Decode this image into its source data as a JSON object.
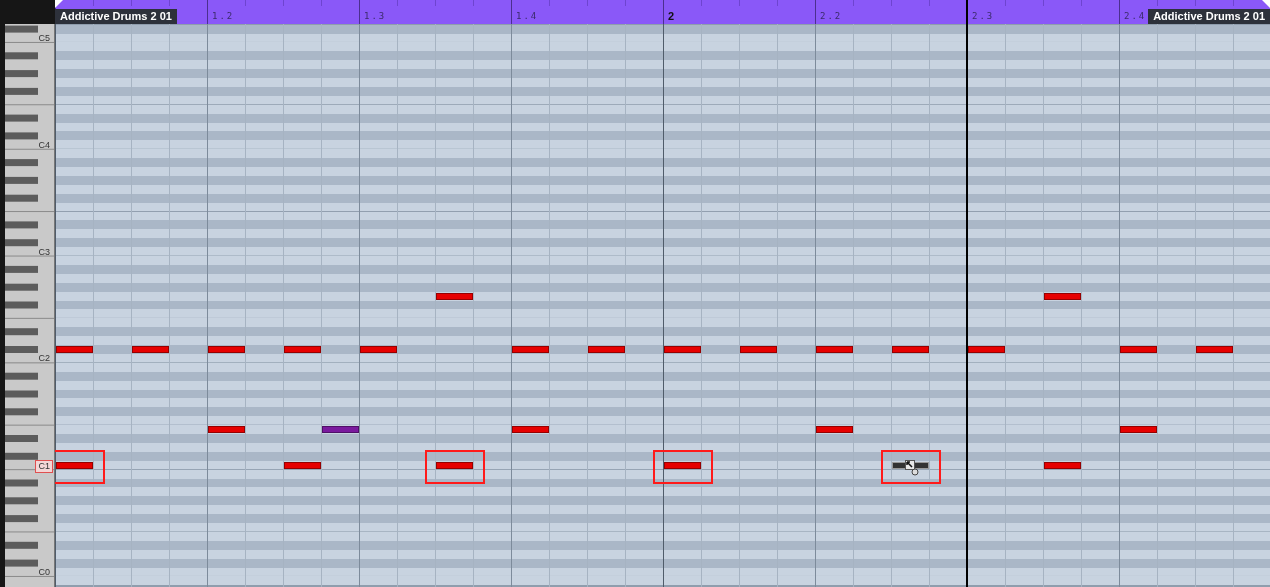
{
  "regions": [
    {
      "label": "Addictive Drums 2 01"
    },
    {
      "label": "Addictive Drums 2 01"
    }
  ],
  "ruler": {
    "beats": [
      {
        "label": "1.2",
        "kind": "beat",
        "playhead": false
      },
      {
        "label": "1.3",
        "kind": "beat",
        "playhead": false
      },
      {
        "label": "1.4",
        "kind": "beat",
        "playhead": false
      },
      {
        "label": "2",
        "kind": "bar",
        "playhead": false
      },
      {
        "label": "2.2",
        "kind": "beat",
        "playhead": false
      },
      {
        "label": "2.3",
        "kind": "beat",
        "playhead": true
      },
      {
        "label": "2.4",
        "kind": "beat",
        "playhead": false
      }
    ]
  },
  "keyboard": {
    "octaves": [
      {
        "label": "C5",
        "selected": false
      },
      {
        "label": "C4",
        "selected": false
      },
      {
        "label": "C3",
        "selected": false
      },
      {
        "label": "C2",
        "selected": false
      },
      {
        "label": "C1",
        "selected": true
      },
      {
        "label": "C0",
        "selected": false
      }
    ]
  },
  "rows": [
    {
      "black_key": true
    },
    {
      "black_key": false
    },
    {
      "black_key": false
    },
    {
      "black_key": true
    },
    {
      "black_key": false
    },
    {
      "black_key": true
    },
    {
      "black_key": false
    },
    {
      "black_key": true
    },
    {
      "black_key": false
    },
    {
      "black_key": false
    },
    {
      "black_key": true
    },
    {
      "black_key": false
    },
    {
      "black_key": true
    },
    {
      "black_key": false
    },
    {
      "black_key": false
    },
    {
      "black_key": true
    },
    {
      "black_key": false
    },
    {
      "black_key": true
    },
    {
      "black_key": false
    },
    {
      "black_key": true
    },
    {
      "black_key": false
    },
    {
      "black_key": false
    },
    {
      "black_key": true
    },
    {
      "black_key": false
    },
    {
      "black_key": true
    },
    {
      "black_key": false
    },
    {
      "black_key": false
    },
    {
      "black_key": true
    },
    {
      "black_key": false
    },
    {
      "black_key": true
    },
    {
      "black_key": false,
      "steps": [
        {
          "kind": "rest"
        },
        {
          "kind": "rest"
        },
        {
          "kind": "rest"
        },
        {
          "kind": "rest"
        },
        {
          "kind": "rest"
        },
        {
          "kind": "rest"
        },
        {
          "kind": "rest"
        },
        {
          "kind": "rest"
        },
        {
          "kind": "rest"
        },
        {
          "kind": "rest"
        },
        {
          "kind": "note",
          "color": "#e60000",
          "selected": false,
          "highlighted": false
        },
        {
          "kind": "rest"
        },
        {
          "kind": "rest"
        },
        {
          "kind": "rest"
        },
        {
          "kind": "rest"
        },
        {
          "kind": "rest"
        },
        {
          "kind": "rest"
        },
        {
          "kind": "rest"
        },
        {
          "kind": "rest"
        },
        {
          "kind": "rest"
        },
        {
          "kind": "rest"
        },
        {
          "kind": "rest"
        },
        {
          "kind": "rest"
        },
        {
          "kind": "rest"
        },
        {
          "kind": "rest"
        },
        {
          "kind": "rest"
        },
        {
          "kind": "note",
          "color": "#e60000",
          "selected": false,
          "highlighted": false
        },
        {
          "kind": "rest"
        },
        {
          "kind": "rest"
        },
        {
          "kind": "rest"
        },
        {
          "kind": "rest"
        },
        {
          "kind": "rest"
        }
      ]
    },
    {
      "black_key": true
    },
    {
      "black_key": false
    },
    {
      "black_key": false
    },
    {
      "black_key": true
    },
    {
      "black_key": false
    },
    {
      "black_key": true,
      "steps": [
        {
          "kind": "note",
          "color": "#e60000",
          "selected": false,
          "highlighted": false
        },
        {
          "kind": "rest"
        },
        {
          "kind": "note",
          "color": "#e60000",
          "selected": false,
          "highlighted": false
        },
        {
          "kind": "rest"
        },
        {
          "kind": "note",
          "color": "#e60000",
          "selected": false,
          "highlighted": false
        },
        {
          "kind": "rest"
        },
        {
          "kind": "note",
          "color": "#e60000",
          "selected": false,
          "highlighted": false
        },
        {
          "kind": "rest"
        },
        {
          "kind": "note",
          "color": "#e60000",
          "selected": false,
          "highlighted": false
        },
        {
          "kind": "rest"
        },
        {
          "kind": "rest"
        },
        {
          "kind": "rest"
        },
        {
          "kind": "note",
          "color": "#e60000",
          "selected": false,
          "highlighted": false
        },
        {
          "kind": "rest"
        },
        {
          "kind": "note",
          "color": "#e60000",
          "selected": false,
          "highlighted": false
        },
        {
          "kind": "rest"
        },
        {
          "kind": "note",
          "color": "#e60000",
          "selected": false,
          "highlighted": false
        },
        {
          "kind": "rest"
        },
        {
          "kind": "note",
          "color": "#e60000",
          "selected": false,
          "highlighted": false
        },
        {
          "kind": "rest"
        },
        {
          "kind": "note",
          "color": "#e60000",
          "selected": false,
          "highlighted": false
        },
        {
          "kind": "rest"
        },
        {
          "kind": "note",
          "color": "#e60000",
          "selected": false,
          "highlighted": false
        },
        {
          "kind": "rest"
        },
        {
          "kind": "note",
          "color": "#e60000",
          "selected": false,
          "highlighted": false
        },
        {
          "kind": "rest"
        },
        {
          "kind": "rest"
        },
        {
          "kind": "rest"
        },
        {
          "kind": "note",
          "color": "#e60000",
          "selected": false,
          "highlighted": false
        },
        {
          "kind": "rest"
        },
        {
          "kind": "note",
          "color": "#e60000",
          "selected": false,
          "highlighted": false
        },
        {
          "kind": "rest"
        }
      ]
    },
    {
      "black_key": false
    },
    {
      "black_key": false
    },
    {
      "black_key": true
    },
    {
      "black_key": false
    },
    {
      "black_key": true
    },
    {
      "black_key": false
    },
    {
      "black_key": true
    },
    {
      "black_key": false
    },
    {
      "black_key": false,
      "steps": [
        {
          "kind": "rest"
        },
        {
          "kind": "rest"
        },
        {
          "kind": "rest"
        },
        {
          "kind": "rest"
        },
        {
          "kind": "note",
          "color": "#e60000",
          "selected": false,
          "highlighted": false
        },
        {
          "kind": "rest"
        },
        {
          "kind": "rest"
        },
        {
          "kind": "note",
          "color": "#7a1a9e",
          "selected": false,
          "highlighted": false
        },
        {
          "kind": "rest"
        },
        {
          "kind": "rest"
        },
        {
          "kind": "rest"
        },
        {
          "kind": "rest"
        },
        {
          "kind": "note",
          "color": "#e60000",
          "selected": false,
          "highlighted": false
        },
        {
          "kind": "rest"
        },
        {
          "kind": "rest"
        },
        {
          "kind": "rest"
        },
        {
          "kind": "rest"
        },
        {
          "kind": "rest"
        },
        {
          "kind": "rest"
        },
        {
          "kind": "rest"
        },
        {
          "kind": "note",
          "color": "#e60000",
          "selected": false,
          "highlighted": false
        },
        {
          "kind": "rest"
        },
        {
          "kind": "rest"
        },
        {
          "kind": "rest"
        },
        {
          "kind": "rest"
        },
        {
          "kind": "rest"
        },
        {
          "kind": "rest"
        },
        {
          "kind": "rest"
        },
        {
          "kind": "note",
          "color": "#e60000",
          "selected": false,
          "highlighted": false
        },
        {
          "kind": "rest"
        },
        {
          "kind": "rest"
        },
        {
          "kind": "rest"
        }
      ]
    },
    {
      "black_key": true
    },
    {
      "black_key": false
    },
    {
      "black_key": true
    },
    {
      "black_key": false,
      "steps": [
        {
          "kind": "note",
          "color": "#e60000",
          "selected": false,
          "highlighted": true
        },
        {
          "kind": "rest"
        },
        {
          "kind": "rest"
        },
        {
          "kind": "rest"
        },
        {
          "kind": "rest"
        },
        {
          "kind": "rest"
        },
        {
          "kind": "note",
          "color": "#e60000",
          "selected": false,
          "highlighted": false
        },
        {
          "kind": "rest"
        },
        {
          "kind": "rest"
        },
        {
          "kind": "rest"
        },
        {
          "kind": "note",
          "color": "#e60000",
          "selected": false,
          "highlighted": true
        },
        {
          "kind": "rest"
        },
        {
          "kind": "rest"
        },
        {
          "kind": "rest"
        },
        {
          "kind": "rest"
        },
        {
          "kind": "rest"
        },
        {
          "kind": "note",
          "color": "#e60000",
          "selected": false,
          "highlighted": true
        },
        {
          "kind": "rest"
        },
        {
          "kind": "rest"
        },
        {
          "kind": "rest"
        },
        {
          "kind": "rest"
        },
        {
          "kind": "rest"
        },
        {
          "kind": "note",
          "color": "#333333",
          "selected": true,
          "highlighted": true
        },
        {
          "kind": "rest"
        },
        {
          "kind": "rest"
        },
        {
          "kind": "rest"
        },
        {
          "kind": "note",
          "color": "#e60000",
          "selected": false,
          "highlighted": false
        },
        {
          "kind": "rest"
        },
        {
          "kind": "rest"
        },
        {
          "kind": "rest"
        },
        {
          "kind": "rest"
        },
        {
          "kind": "rest"
        }
      ]
    },
    {
      "black_key": false
    },
    {
      "black_key": true
    },
    {
      "black_key": false
    },
    {
      "black_key": true
    },
    {
      "black_key": false
    },
    {
      "black_key": true
    },
    {
      "black_key": false
    },
    {
      "black_key": false
    },
    {
      "black_key": true
    },
    {
      "black_key": false
    },
    {
      "black_key": true
    },
    {
      "black_key": false
    },
    {
      "black_key": false
    }
  ]
}
